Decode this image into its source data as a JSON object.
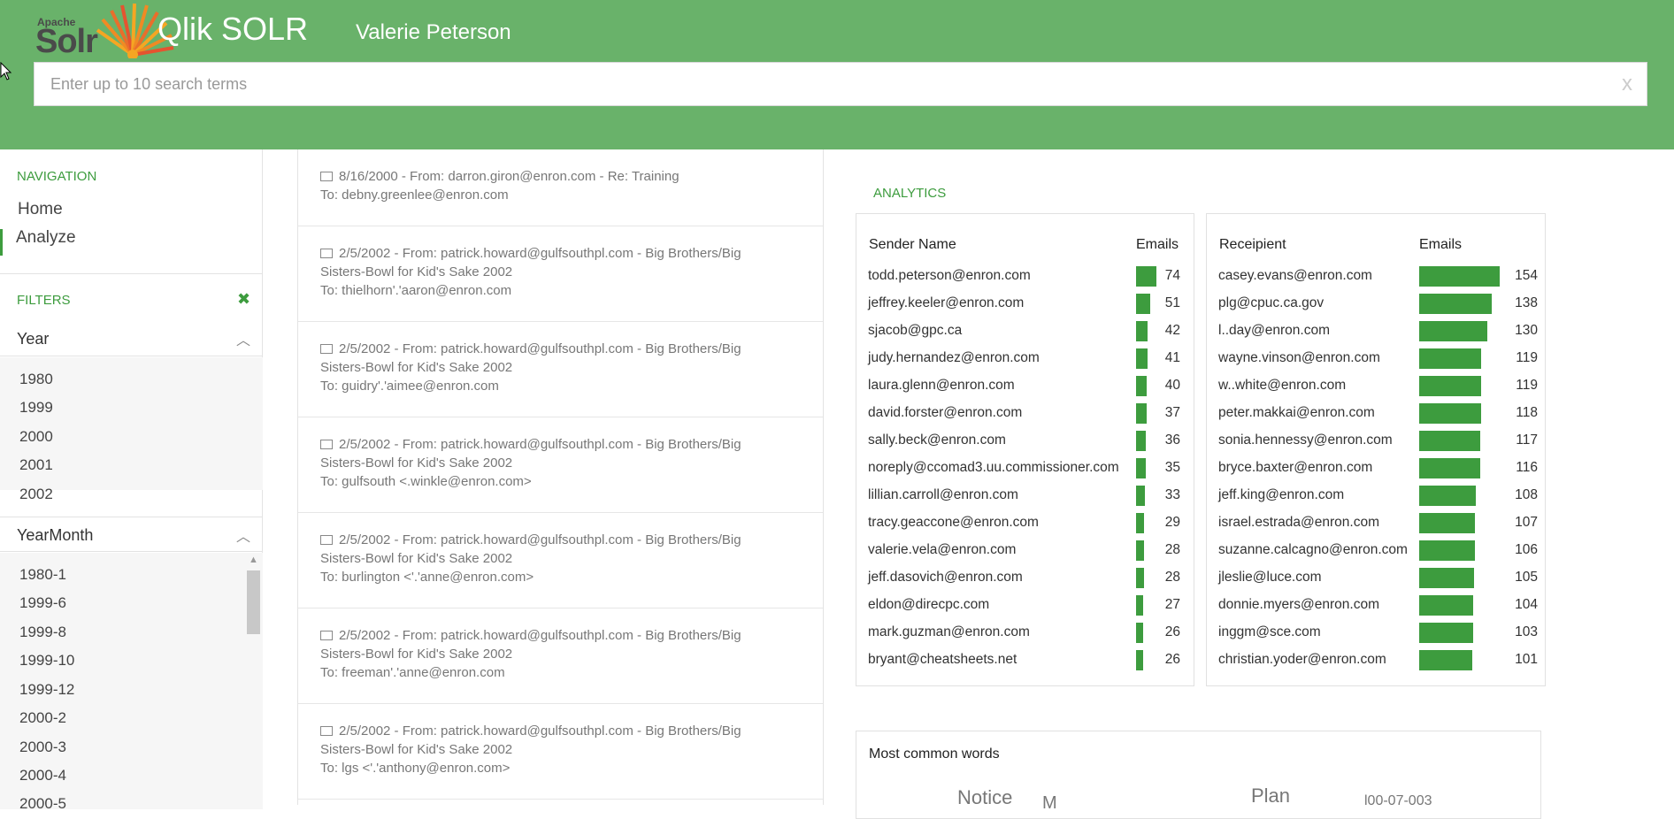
{
  "header": {
    "logo_small": "Apache",
    "logo_main": "Solr",
    "title": "Qlik SOLR",
    "user": "Valerie Peterson",
    "search_placeholder": "Enter up to 10 search terms",
    "clear_label": "x"
  },
  "sidebar": {
    "nav_title": "NAVIGATION",
    "nav_items": [
      "Home",
      "Analyze"
    ],
    "filters_title": "FILTERS",
    "clear_filters_icon": "✖",
    "year": {
      "label": "Year",
      "items": [
        "1980",
        "1999",
        "2000",
        "2001",
        "2002"
      ]
    },
    "yearmonth": {
      "label": "YearMonth",
      "items": [
        "1980-1",
        "1999-6",
        "1999-8",
        "1999-10",
        "1999-12",
        "2000-2",
        "2000-3",
        "2000-4",
        "2000-5"
      ]
    }
  },
  "emails": [
    {
      "line1": "8/16/2000  -  From: darron.giron@enron.com   -  Re: Training",
      "line2": "To: debny.greenlee@enron.com",
      "line3": ""
    },
    {
      "line1": "2/5/2002  -  From: patrick.howard@gulfsouthpl.com   -  Big Brothers/Big",
      "line2": "Sisters-Bowl for Kid's Sake 2002",
      "line3": "To: thielhorn'.'aaron@enron.com"
    },
    {
      "line1": "2/5/2002  -  From: patrick.howard@gulfsouthpl.com   -  Big Brothers/Big",
      "line2": "Sisters-Bowl for Kid's Sake 2002",
      "line3": "To: guidry'.'aimee@enron.com"
    },
    {
      "line1": "2/5/2002  -  From: patrick.howard@gulfsouthpl.com   -  Big Brothers/Big",
      "line2": "Sisters-Bowl for Kid's Sake 2002",
      "line3": "To: gulfsouth <.winkle@enron.com>"
    },
    {
      "line1": "2/5/2002  -  From: patrick.howard@gulfsouthpl.com   -  Big Brothers/Big",
      "line2": "Sisters-Bowl for Kid's Sake 2002",
      "line3": "To: burlington <'.'anne@enron.com>"
    },
    {
      "line1": "2/5/2002  -  From: patrick.howard@gulfsouthpl.com   -  Big Brothers/Big",
      "line2": "Sisters-Bowl for Kid's Sake 2002",
      "line3": "To: freeman'.'anne@enron.com"
    },
    {
      "line1": "2/5/2002  -  From: patrick.howard@gulfsouthpl.com   -  Big Brothers/Big",
      "line2": "Sisters-Bowl for Kid's Sake 2002",
      "line3": "To: lgs <'.'anthony@enron.com>"
    }
  ],
  "analytics": {
    "title": "ANALYTICS",
    "accent_color": "#3d9c3e",
    "senders": {
      "col_name": "Sender Name",
      "col_count": "Emails",
      "max": 74,
      "rows": [
        {
          "name": "todd.peterson@enron.com",
          "count": 74
        },
        {
          "name": "jeffrey.keeler@enron.com",
          "count": 51
        },
        {
          "name": "sjacob@gpc.ca",
          "count": 42
        },
        {
          "name": "judy.hernandez@enron.com",
          "count": 41
        },
        {
          "name": "laura.glenn@enron.com",
          "count": 40
        },
        {
          "name": "david.forster@enron.com",
          "count": 37
        },
        {
          "name": "sally.beck@enron.com",
          "count": 36
        },
        {
          "name": "noreply@ccomad3.uu.commissioner.com",
          "count": 35
        },
        {
          "name": "lillian.carroll@enron.com",
          "count": 33
        },
        {
          "name": "tracy.geaccone@enron.com",
          "count": 29
        },
        {
          "name": "valerie.vela@enron.com",
          "count": 28
        },
        {
          "name": "jeff.dasovich@enron.com",
          "count": 28
        },
        {
          "name": "eldon@direcpc.com",
          "count": 27
        },
        {
          "name": "mark.guzman@enron.com",
          "count": 26
        },
        {
          "name": "bryant@cheatsheets.net",
          "count": 26
        }
      ]
    },
    "recipients": {
      "col_name": "Receipient",
      "col_count": "Emails",
      "max": 154,
      "rows": [
        {
          "name": "casey.evans@enron.com",
          "count": 154
        },
        {
          "name": "plg@cpuc.ca.gov",
          "count": 138
        },
        {
          "name": "l..day@enron.com",
          "count": 130
        },
        {
          "name": "wayne.vinson@enron.com",
          "count": 119
        },
        {
          "name": "w..white@enron.com",
          "count": 119
        },
        {
          "name": "peter.makkai@enron.com",
          "count": 118
        },
        {
          "name": "sonia.hennessy@enron.com",
          "count": 117
        },
        {
          "name": "bryce.baxter@enron.com",
          "count": 116
        },
        {
          "name": "jeff.king@enron.com",
          "count": 108
        },
        {
          "name": "israel.estrada@enron.com",
          "count": 107
        },
        {
          "name": "suzanne.calcagno@enron.com",
          "count": 106
        },
        {
          "name": "jleslie@luce.com",
          "count": 105
        },
        {
          "name": "donnie.myers@enron.com",
          "count": 104
        },
        {
          "name": "inggm@sce.com",
          "count": 103
        },
        {
          "name": "christian.yoder@enron.com",
          "count": 101
        }
      ]
    },
    "words": {
      "title": "Most common words",
      "items": [
        "Notice",
        "M",
        "Plan",
        "l00-07-003"
      ]
    }
  }
}
